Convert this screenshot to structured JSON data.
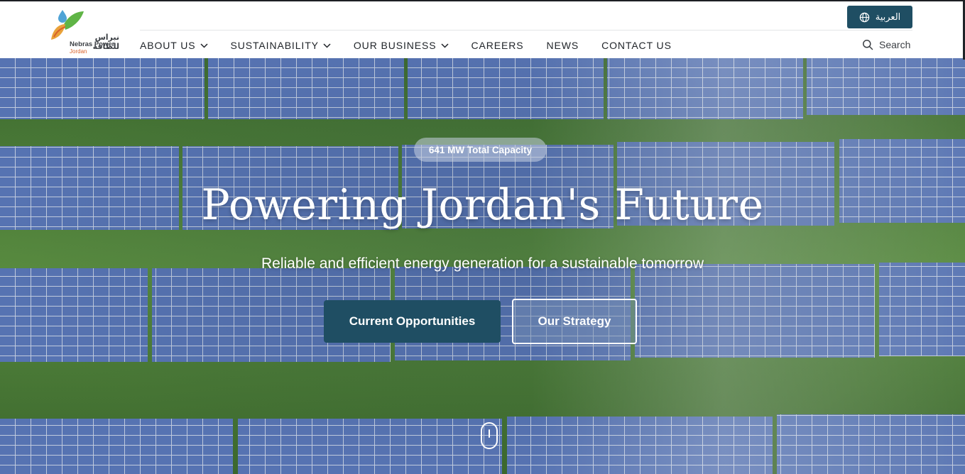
{
  "header": {
    "logo": {
      "arabic_name": "نبراس للطاقة",
      "english_name": "Nebras Power",
      "region": "Jordan"
    },
    "language_button": {
      "label": "العربية",
      "icon": "globe-icon"
    },
    "nav": {
      "items": [
        {
          "label": "ABOUT US",
          "has_dropdown": true
        },
        {
          "label": "SUSTAINABILITY",
          "has_dropdown": true
        },
        {
          "label": "OUR BUSINESS",
          "has_dropdown": true
        },
        {
          "label": "CAREERS",
          "has_dropdown": false
        },
        {
          "label": "NEWS",
          "has_dropdown": false
        },
        {
          "label": "CONTACT US",
          "has_dropdown": false
        }
      ]
    },
    "search": {
      "label": "Search",
      "icon": "search-icon"
    }
  },
  "hero": {
    "badge": "641 MW Total Capacity",
    "title": "Powering Jordan's Future",
    "subtitle": "Reliable and efficient energy generation for a sustainable tomorrow",
    "primary_button": "Current Opportunities",
    "secondary_button": "Our Strategy",
    "scroll_indicator_icon": "mouse-scroll-icon"
  },
  "colors": {
    "brand_primary": "#1f4e63",
    "nav_text": "#1f2328",
    "logo_accent": "#d9622b"
  }
}
